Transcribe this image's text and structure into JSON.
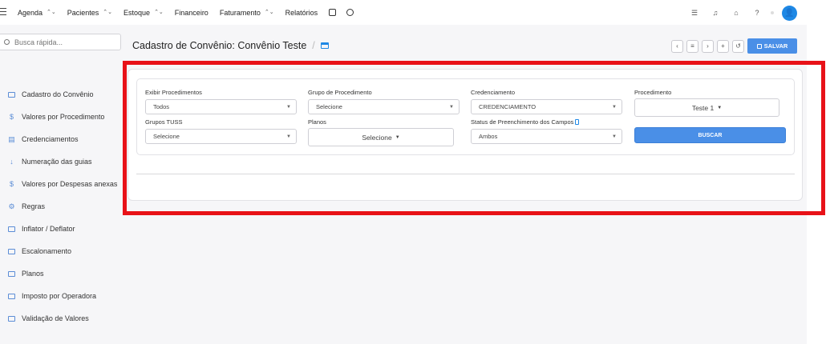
{
  "topbar": {
    "nav": [
      {
        "label": "Agenda",
        "caret": "⌃⌄"
      },
      {
        "label": "Pacientes",
        "caret": "⌃⌄"
      },
      {
        "label": "Estoque",
        "caret": "⌃⌄"
      },
      {
        "label": "Financeiro"
      },
      {
        "label": "Faturamento",
        "caret": "⌃⌄"
      },
      {
        "label": "Relatórios"
      }
    ],
    "icons": [
      "list-icon",
      "bell-icon",
      "chat-icon",
      "help-icon"
    ],
    "avatar_glyph": "👤"
  },
  "sidebar": {
    "search_placeholder": "Busca rápida...",
    "items": [
      {
        "label": "Cadastro do Convênio",
        "icon": "card-icon"
      },
      {
        "label": "Valores por Procedimento",
        "icon": "dollar-icon"
      },
      {
        "label": "Credenciamentos",
        "icon": "document-icon"
      },
      {
        "label": "Numeração das guias",
        "icon": "sort-numeric-icon"
      },
      {
        "label": "Valores por Despesas anexas",
        "icon": "dollar-icon"
      },
      {
        "label": "Regras",
        "icon": "gears-icon"
      },
      {
        "label": "Inflator / Deflator",
        "icon": "money-icon"
      },
      {
        "label": "Escalonamento",
        "icon": "money-icon"
      },
      {
        "label": "Planos",
        "icon": "list-box-icon"
      },
      {
        "label": "Imposto por Operadora",
        "icon": "money-icon"
      },
      {
        "label": "Validação de Valores",
        "icon": "money-icon"
      }
    ]
  },
  "header": {
    "title": "Cadastro de Convênio: Convênio Teste",
    "separator": "/",
    "save_label": "SALVAR"
  },
  "filters": {
    "exibir_label": "Exibir Procedimentos",
    "exibir_value": "Todos",
    "grupo_label": "Grupo de Procedimento",
    "grupo_value": "Selecione",
    "cred_label": "Credenciamento",
    "cred_value": "CREDENCIAMENTO",
    "proc_label": "Procedimento",
    "proc_value": "Teste 1",
    "tuss_label": "Grupos TUSS",
    "tuss_value": "Selecione",
    "planos_label": "Planos",
    "planos_value": "Selecione",
    "status_label": "Status de Preenchimento dos Campos",
    "status_value": "Ambos",
    "search_button": "BUSCAR"
  },
  "colors": {
    "accent": "#4a8fe7",
    "highlight": "#e81218",
    "avatar": "#1e88e5"
  }
}
